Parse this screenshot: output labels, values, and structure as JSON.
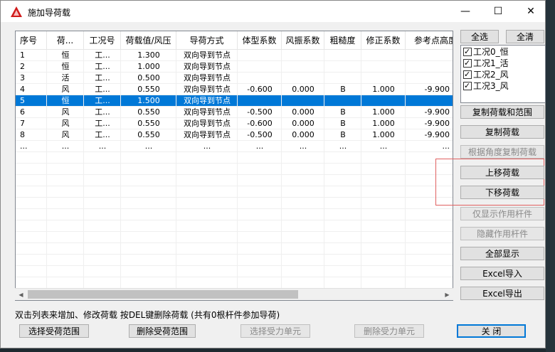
{
  "window": {
    "title": "施加导荷载",
    "minimize": "—",
    "maximize": "☐",
    "close": "✕"
  },
  "table": {
    "headers": [
      "序号",
      "荷...",
      "工况号",
      "荷载值/风压",
      "导荷方式",
      "体型系数",
      "风振系数",
      "粗糙度",
      "修正系数",
      "参考点高度"
    ],
    "rows": [
      [
        "1",
        "恒",
        "工...",
        "1.300",
        "双向导到节点",
        "",
        "",
        "",
        "",
        ""
      ],
      [
        "2",
        "恒",
        "工...",
        "1.000",
        "双向导到节点",
        "",
        "",
        "",
        "",
        ""
      ],
      [
        "3",
        "活",
        "工...",
        "0.500",
        "双向导到节点",
        "",
        "",
        "",
        "",
        ""
      ],
      [
        "4",
        "风",
        "工...",
        "0.550",
        "双向导到节点",
        "-0.600",
        "0.000",
        "B",
        "1.000",
        "-9.900"
      ],
      [
        "5",
        "恒",
        "工...",
        "1.500",
        "双向导到节点",
        "",
        "",
        "",
        "",
        ""
      ],
      [
        "6",
        "风",
        "工...",
        "0.550",
        "双向导到节点",
        "-0.500",
        "0.000",
        "B",
        "1.000",
        "-9.900"
      ],
      [
        "7",
        "风",
        "工...",
        "0.550",
        "双向导到节点",
        "-0.600",
        "0.000",
        "B",
        "1.000",
        "-9.900"
      ],
      [
        "8",
        "风",
        "工...",
        "0.550",
        "双向导到节点",
        "-0.500",
        "0.000",
        "B",
        "1.000",
        "-9.900"
      ],
      [
        "...",
        "...",
        "...",
        "...",
        "...",
        "...",
        "...",
        "...",
        "...",
        "..."
      ]
    ],
    "selected_index": 4
  },
  "side": {
    "select_all": "全选",
    "clear_all": "全清",
    "cases": [
      "工况0_恒",
      "工况1_活",
      "工况2_风",
      "工况3_风"
    ],
    "copy_load_range": "复制荷载和范围",
    "copy_load": "复制荷载",
    "copy_by_angle": "根据角度复制荷载",
    "move_up": "上移荷载",
    "move_down": "下移荷载",
    "show_only_members": "仅显示作用杆件",
    "hide_members": "隐藏作用杆件",
    "show_all": "全部显示",
    "excel_import": "Excel导入",
    "excel_export": "Excel导出"
  },
  "bottom": {
    "status": "双击列表来增加、修改荷载  按DEL键删除荷载  (共有0根杆件参加导荷)",
    "select_range": "选择受荷范围",
    "delete_range": "删除受荷范围",
    "select_unit": "选择受力单元",
    "delete_unit": "删除受力单元",
    "close": "关   闭"
  }
}
